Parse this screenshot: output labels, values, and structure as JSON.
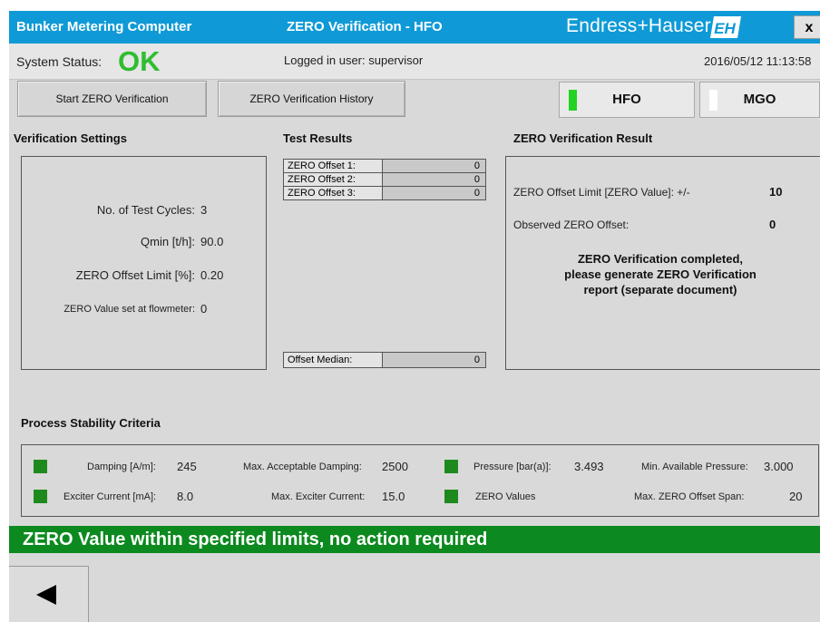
{
  "titlebar": {
    "app_title": "Bunker Metering Computer",
    "screen_title": "ZERO Verification - HFO",
    "brand": "Endress+Hauser",
    "logo_text": "EH",
    "close_label": "x"
  },
  "status": {
    "label": "System Status:",
    "value": "OK",
    "user": "Logged in user: supervisor",
    "datetime": "2016/05/12 11:13:58"
  },
  "nav": {
    "start_btn": "Start ZERO Verification",
    "history_btn": "ZERO Verification History",
    "fluid_hfo": "HFO",
    "fluid_mgo": "MGO"
  },
  "settings": {
    "title": "Verification Settings",
    "test_cycles_label": "No. of Test Cycles:",
    "test_cycles_value": "3",
    "qmin_label": "Qmin [t/h]:",
    "qmin_value": "90.0",
    "offset_limit_label": "ZERO Offset Limit [%]:",
    "offset_limit_value": "0.20",
    "zero_value_label": "ZERO Value set at flowmeter:",
    "zero_value_value": "0"
  },
  "results": {
    "title": "Test Results",
    "rows": [
      {
        "label": "ZERO Offset 1:",
        "value": "0"
      },
      {
        "label": "ZERO Offset 2:",
        "value": "0"
      },
      {
        "label": "ZERO Offset 3:",
        "value": "0"
      }
    ],
    "median_label": "Offset Median:",
    "median_value": "0"
  },
  "verification": {
    "title": "ZERO Verification Result",
    "limit_label": "ZERO Offset Limit [ZERO Value]: +/-",
    "limit_value": "10",
    "observed_label": "Observed ZERO Offset:",
    "observed_value": "0",
    "msg_line1": "ZERO Verification completed,",
    "msg_line2": "please generate ZERO Verification",
    "msg_line3": "report (separate document)"
  },
  "stability": {
    "title": "Process Stability Criteria",
    "damping_label": "Damping [A/m]:",
    "damping_value": "245",
    "max_damping_label": "Max. Acceptable Damping:",
    "max_damping_value": "2500",
    "pressure_label": "Pressure [bar(a)]:",
    "pressure_value": "3.493",
    "min_pressure_label": "Min. Available Pressure:",
    "min_pressure_value": "3.000",
    "exciter_label": "Exciter Current [mA]:",
    "exciter_value": "8.0",
    "max_exciter_label": "Max. Exciter Current:",
    "max_exciter_value": "15.0",
    "zero_values_label": "ZERO Values",
    "max_span_label": "Max. ZERO Offset Span:",
    "max_span_value": "20"
  },
  "banner": "ZERO Value within specified limits, no action required",
  "colors": {
    "titlebar": "#0f9ad7",
    "ok": "#2fbd2f",
    "criteria_ok": "#1e8a1e",
    "banner": "#0c8a1f",
    "indicator_on": "#22d322",
    "indicator_off": "#ffffff"
  },
  "icons": {
    "back": "triangle-left-icon",
    "logo": "endress-hauser-logo"
  }
}
